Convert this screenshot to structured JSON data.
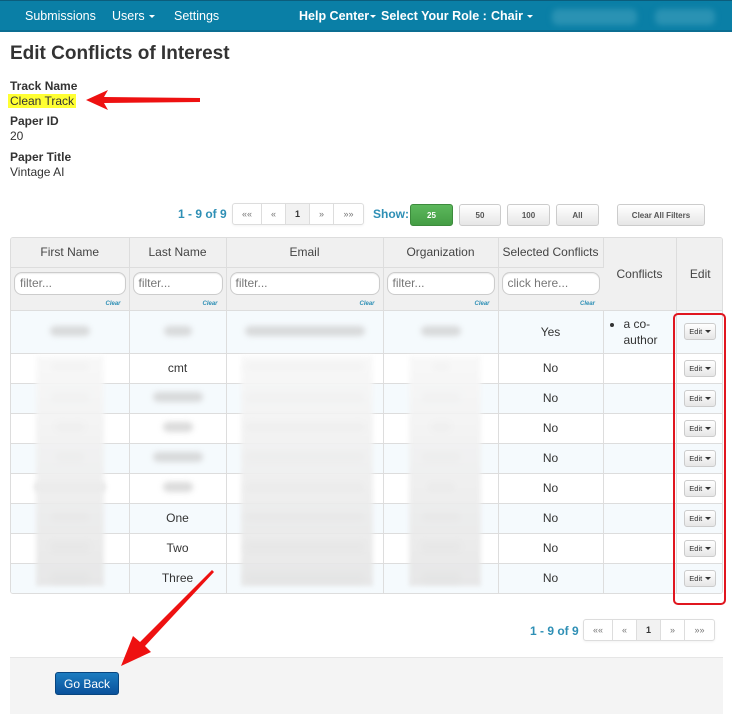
{
  "navbar": {
    "items": [
      {
        "label": "Submissions",
        "has_caret": false
      },
      {
        "label": "Users",
        "has_caret": true
      },
      {
        "label": "Settings",
        "has_caret": false
      }
    ],
    "help_center": "Help Center",
    "role_label": "Select Your Role :",
    "role_value": "Chair"
  },
  "page": {
    "title": "Edit Conflicts of Interest",
    "track_name_label": "Track Name",
    "track_name_value": "Clean Track",
    "paper_id_label": "Paper ID",
    "paper_id_value": "20",
    "paper_title_label": "Paper Title",
    "paper_title_value": "Vintage AI"
  },
  "pagination": {
    "summary": "1 - 9 of 9",
    "first": "««",
    "prev": "«",
    "current": "1",
    "next": "»",
    "last": "»»"
  },
  "show": {
    "label": "Show:",
    "options": [
      "25",
      "50",
      "100",
      "All"
    ],
    "selected": "25",
    "clear_filters": "Clear All Filters"
  },
  "table": {
    "columns": [
      "First Name",
      "Last Name",
      "Email",
      "Organization",
      "Selected Conflicts",
      "Conflicts",
      "Edit"
    ],
    "filters": {
      "first_name": "filter...",
      "last_name": "filter...",
      "email": "filter...",
      "organization": "filter...",
      "selected_conflicts": "click here...",
      "clear": "Clear"
    },
    "rows": [
      {
        "last_name": "",
        "selected": "Yes",
        "conflicts": [
          "a co-author"
        ],
        "edit": "Edit"
      },
      {
        "last_name": "cmt",
        "selected": "No",
        "conflicts": [],
        "edit": "Edit"
      },
      {
        "last_name": "",
        "selected": "No",
        "conflicts": [],
        "edit": "Edit"
      },
      {
        "last_name": "",
        "selected": "No",
        "conflicts": [],
        "edit": "Edit"
      },
      {
        "last_name": "",
        "selected": "No",
        "conflicts": [],
        "edit": "Edit"
      },
      {
        "last_name": "",
        "selected": "No",
        "conflicts": [],
        "edit": "Edit"
      },
      {
        "last_name": "One",
        "selected": "No",
        "conflicts": [],
        "edit": "Edit"
      },
      {
        "last_name": "Two",
        "selected": "No",
        "conflicts": [],
        "edit": "Edit"
      },
      {
        "last_name": "Three",
        "selected": "No",
        "conflicts": [],
        "edit": "Edit"
      }
    ]
  },
  "footer": {
    "go_back": "Go Back"
  },
  "colors": {
    "navbar": "#0a7fa6",
    "accent_link": "#2e8fb5",
    "show_active": "#5cb85c",
    "annotation_red": "#e0161f",
    "highlight": "#ffff33",
    "primary_button": "#0a519b"
  }
}
